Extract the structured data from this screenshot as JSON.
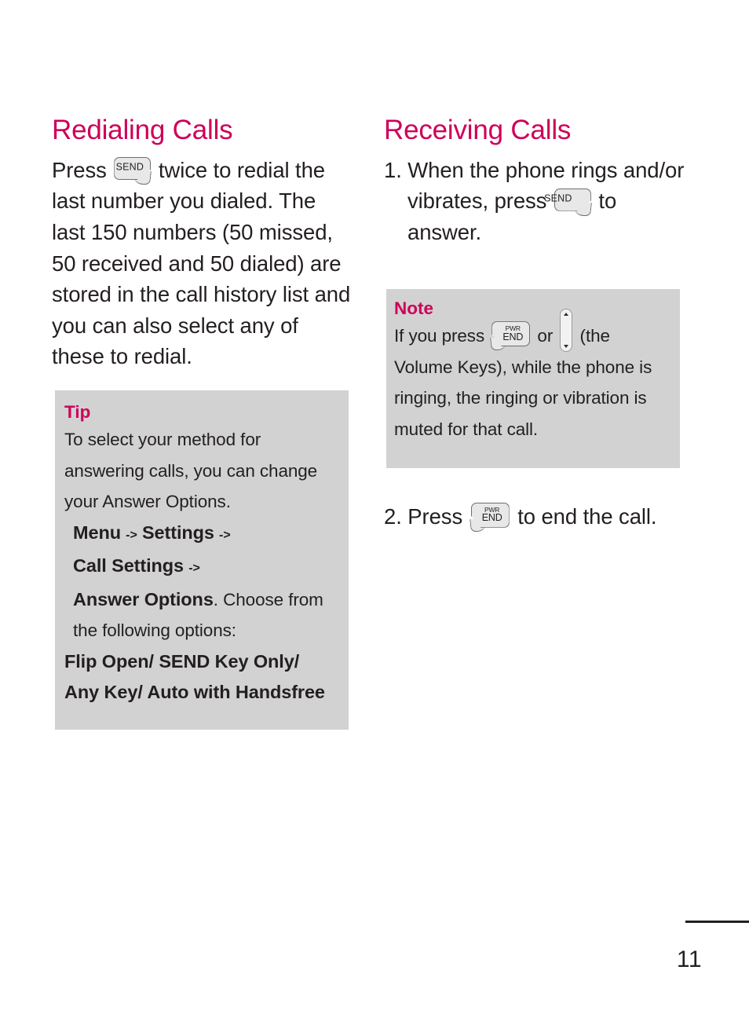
{
  "document": {
    "page_number": "11",
    "accent_color": "#ce0058",
    "callout_bg": "#d2d2d2",
    "text_color": "#231f20"
  },
  "left_column": {
    "heading": "Redialing Calls",
    "paragraph": {
      "before_key": "Press",
      "key_icon": "send-key-icon",
      "key_label": "SEND",
      "after_key": "twice to redial the last number you dialed.  The last 150 numbers (50 missed, 50 received and 50 dialed) are stored in the call history list and you can also select any of these to redial."
    },
    "tip_box": {
      "title": "Tip",
      "line1": "To select your method for answering calls, you can change your Answer Options.",
      "menu_path": {
        "item1": "Menu",
        "arrow1": "->",
        "item2": "Settings",
        "arrow2": "->",
        "item3": "Call Settings",
        "arrow3": "->",
        "item4": "Answer Options"
      },
      "line2": ". Choose from the following options:",
      "options_line1": "Flip Open/ SEND Key Only/",
      "options_line2": "Any Key/ Auto with Handsfree"
    }
  },
  "right_column": {
    "heading": "Receiving Calls",
    "step1": {
      "number": "1.",
      "before_key": "When the phone rings and/or vibrates, press",
      "key_icon": "send-key-icon",
      "key_label": "SEND",
      "after_key": "to answer."
    },
    "note_box": {
      "title": "Note",
      "before_key": "If you press",
      "key1_icon": "power-end-key-icon",
      "key1_label_top": "PWR",
      "key1_label_bottom": "END",
      "conjunction": "or",
      "key2_icon": "volume-keys-icon",
      "after_keys": "(the Volume Keys), while the phone is ringing, the ringing or vibration is muted for that call."
    },
    "step2": {
      "number": "2.",
      "before_key": "Press",
      "key_icon": "power-end-key-icon",
      "key_label_top": "PWR",
      "key_label_bottom": "END",
      "after_key": "to end the call."
    }
  }
}
